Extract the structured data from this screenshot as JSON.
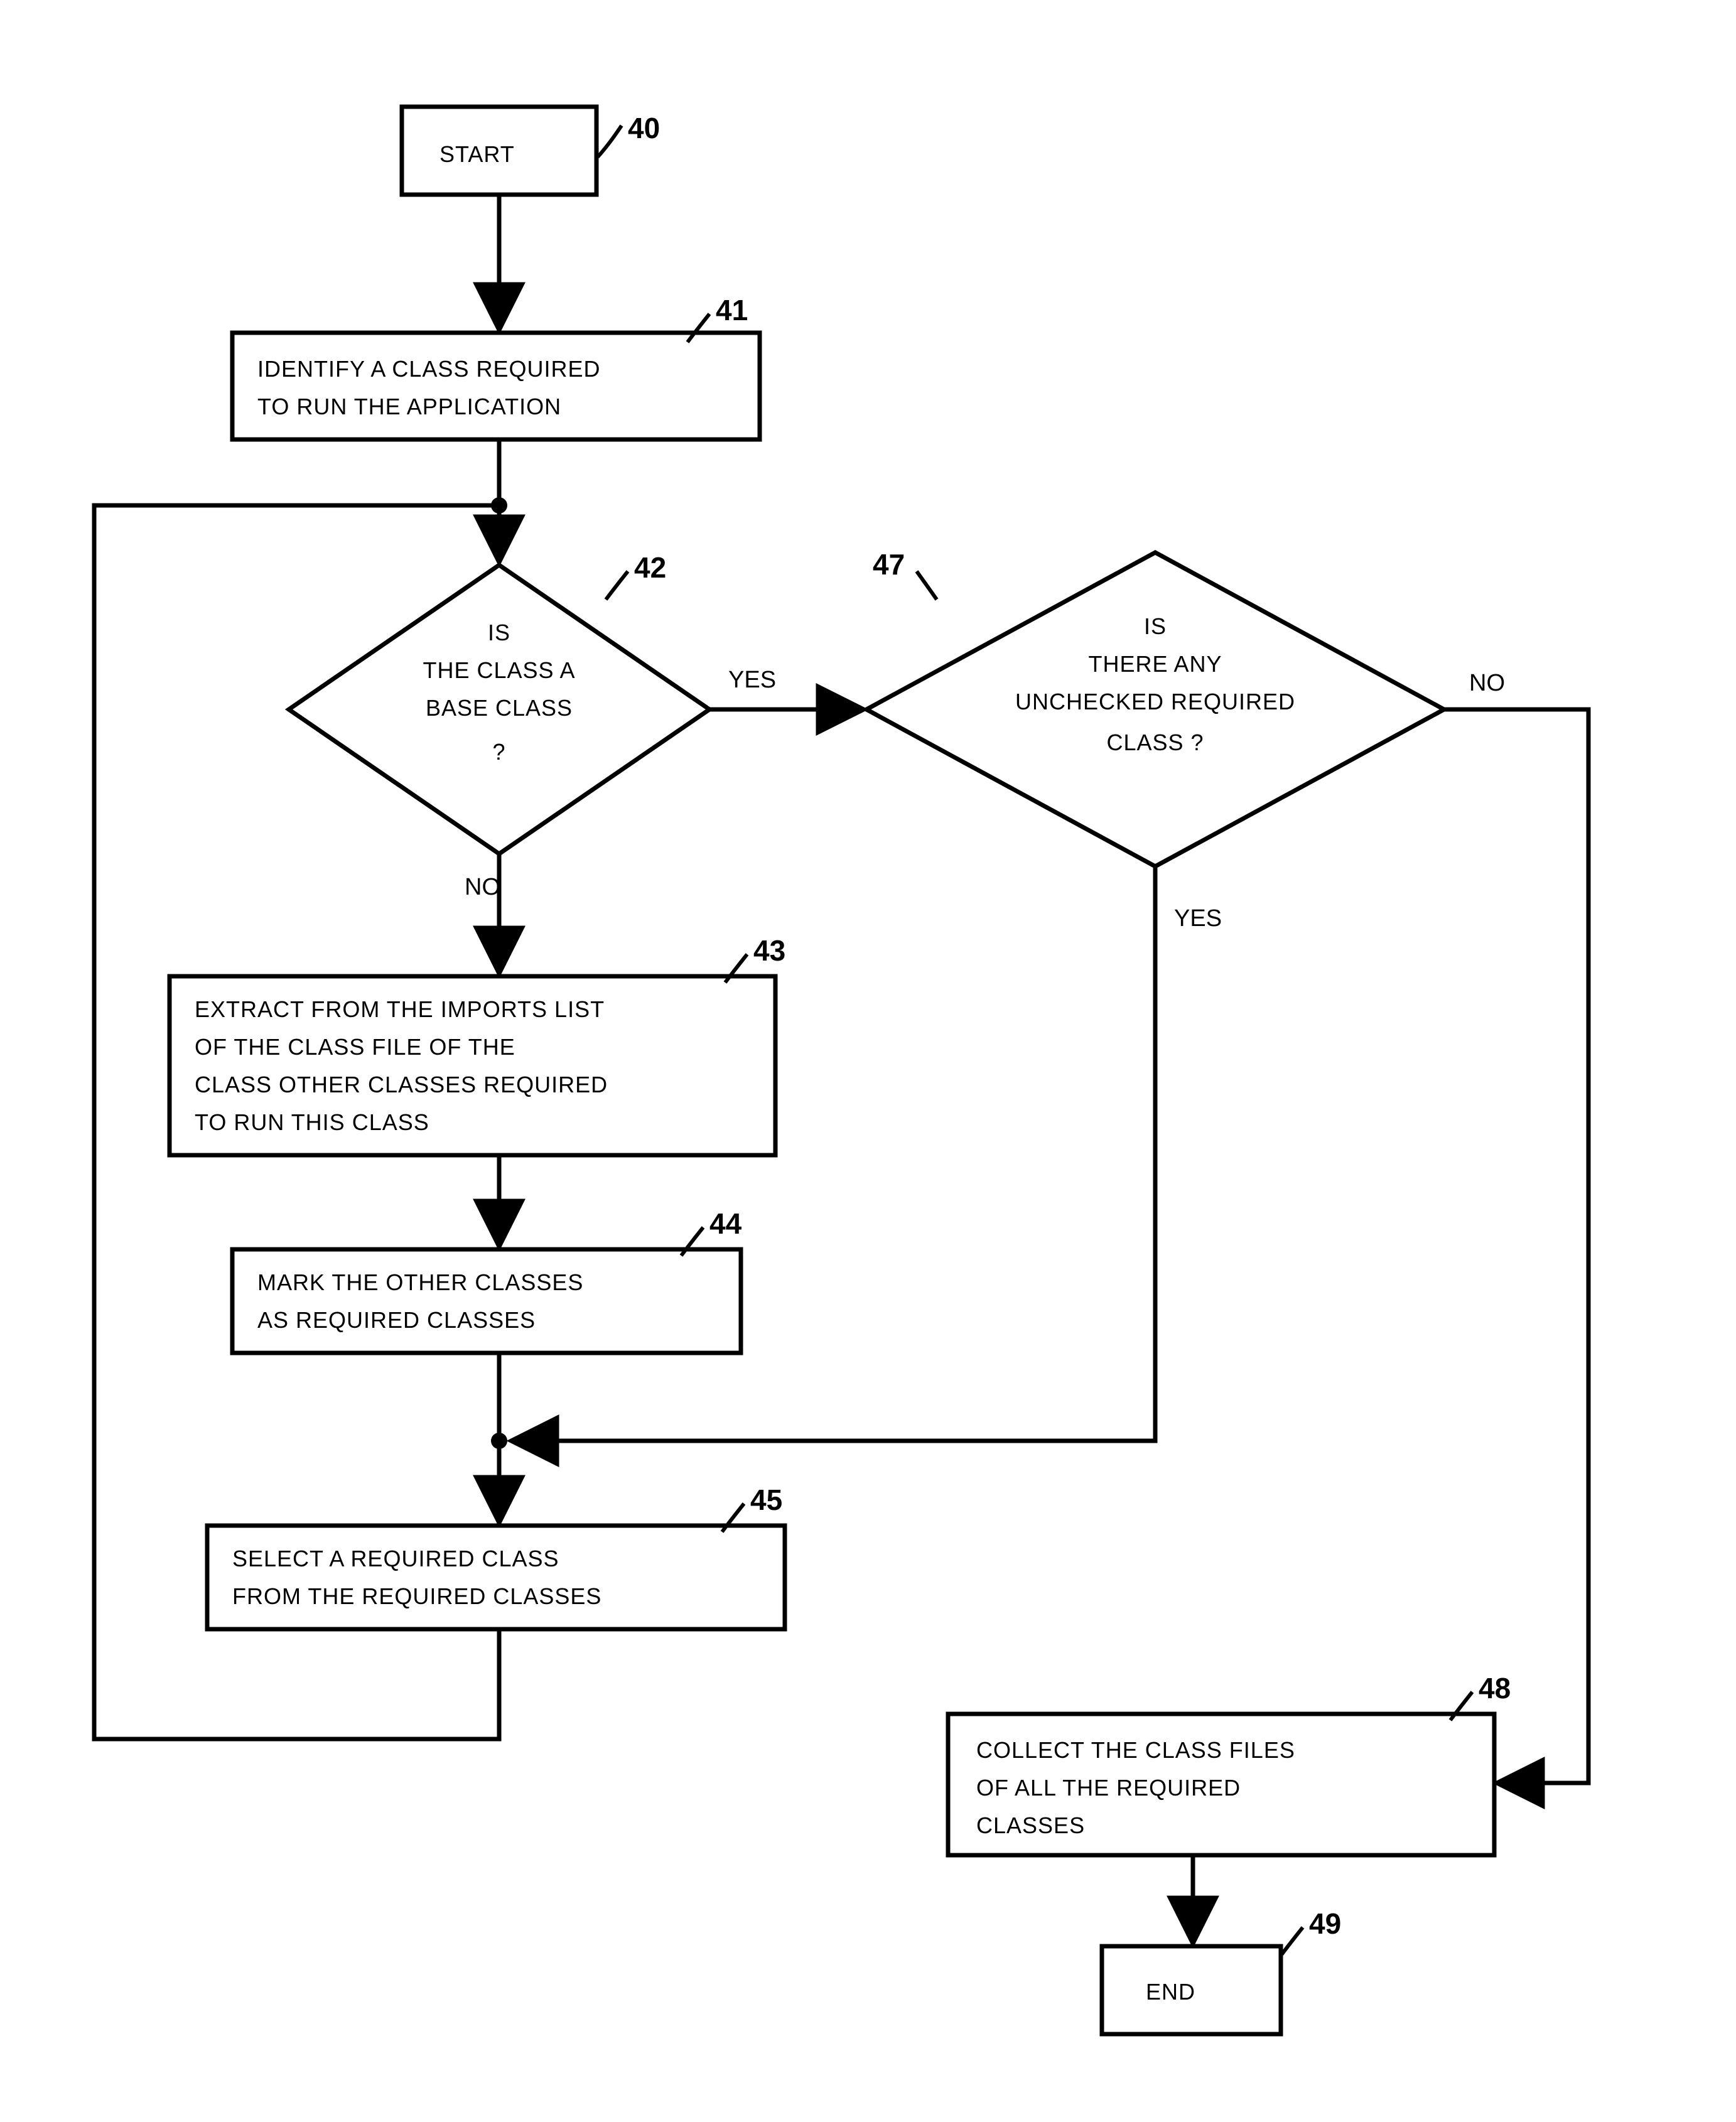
{
  "nodes": {
    "start": {
      "ref": "40",
      "text": "START"
    },
    "identify": {
      "ref": "41",
      "lines": [
        "IDENTIFY A CLASS REQUIRED",
        "TO RUN THE APPLICATION"
      ]
    },
    "baseClass": {
      "ref": "42",
      "lines": [
        "IS",
        "THE CLASS A",
        "BASE CLASS",
        "?"
      ],
      "yes": "YES",
      "no": "NO"
    },
    "unchecked": {
      "ref": "47",
      "lines": [
        "IS",
        "THERE ANY",
        "UNCHECKED REQUIRED",
        "CLASS ?"
      ],
      "yes": "YES",
      "no": "NO"
    },
    "extract": {
      "ref": "43",
      "lines": [
        "EXTRACT FROM THE IMPORTS LIST",
        "OF THE CLASS FILE OF THE",
        "CLASS OTHER CLASSES REQUIRED",
        "TO RUN THIS CLASS"
      ]
    },
    "mark": {
      "ref": "44",
      "lines": [
        "MARK THE OTHER CLASSES",
        "AS REQUIRED CLASSES"
      ]
    },
    "select": {
      "ref": "45",
      "lines": [
        "SELECT A REQUIRED CLASS",
        "FROM THE REQUIRED CLASSES"
      ]
    },
    "collect": {
      "ref": "48",
      "lines": [
        "COLLECT THE CLASS FILES",
        "OF ALL THE REQUIRED",
        "CLASSES"
      ]
    },
    "end": {
      "ref": "49",
      "text": "END"
    }
  }
}
